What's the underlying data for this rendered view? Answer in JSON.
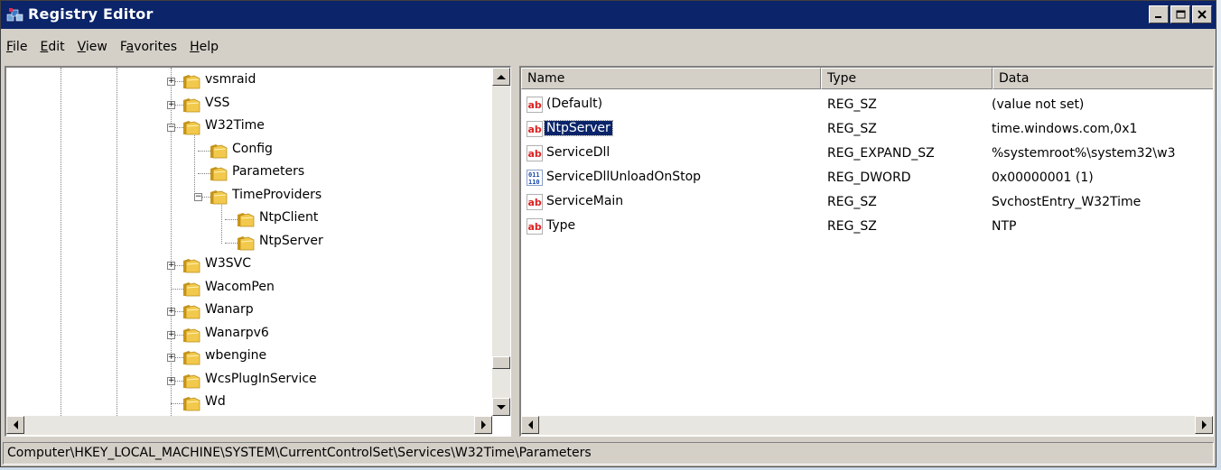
{
  "window": {
    "title": "Registry Editor"
  },
  "menu": [
    {
      "pre": "",
      "u": "F",
      "post": "ile"
    },
    {
      "pre": "",
      "u": "E",
      "post": "dit"
    },
    {
      "pre": "",
      "u": "V",
      "post": "iew"
    },
    {
      "pre": "F",
      "u": "a",
      "post": "vorites"
    },
    {
      "pre": "",
      "u": "H",
      "post": "elp"
    }
  ],
  "tree": {
    "nodes": [
      {
        "label": "vsmraid",
        "expander": "+"
      },
      {
        "label": "VSS",
        "expander": "+"
      },
      {
        "label": "W32Time",
        "expander": "-"
      },
      {
        "label": "Config",
        "expander": ""
      },
      {
        "label": "Parameters",
        "expander": ""
      },
      {
        "label": "TimeProviders",
        "expander": "-"
      },
      {
        "label": "NtpClient",
        "expander": ""
      },
      {
        "label": "NtpServer",
        "expander": ""
      },
      {
        "label": "W3SVC",
        "expander": "+"
      },
      {
        "label": "WacomPen",
        "expander": ""
      },
      {
        "label": "Wanarp",
        "expander": "+"
      },
      {
        "label": "Wanarpv6",
        "expander": "+"
      },
      {
        "label": "wbengine",
        "expander": "+"
      },
      {
        "label": "WcsPlugInService",
        "expander": "+"
      },
      {
        "label": "Wd",
        "expander": ""
      }
    ]
  },
  "list": {
    "columns": [
      "Name",
      "Type",
      "Data"
    ],
    "rows": [
      {
        "icon": "string-value-icon",
        "name": "(Default)",
        "type": "REG_SZ",
        "data": "(value not set)"
      },
      {
        "icon": "string-value-icon",
        "name": "NtpServer",
        "type": "REG_SZ",
        "data": "time.windows.com,0x1"
      },
      {
        "icon": "string-value-icon",
        "name": "ServiceDll",
        "type": "REG_EXPAND_SZ",
        "data": "%systemroot%\\system32\\w3"
      },
      {
        "icon": "binary-value-icon",
        "name": "ServiceDllUnloadOnStop",
        "type": "REG_DWORD",
        "data": "0x00000001 (1)"
      },
      {
        "icon": "string-value-icon",
        "name": "ServiceMain",
        "type": "REG_SZ",
        "data": "SvchostEntry_W32Time"
      },
      {
        "icon": "string-value-icon",
        "name": "Type",
        "type": "REG_SZ",
        "data": "NTP"
      }
    ],
    "selected_name": "NtpServer"
  },
  "status": {
    "path": "Computer\\HKEY_LOCAL_MACHINE\\SYSTEM\\CurrentControlSet\\Services\\W32Time\\Parameters"
  },
  "colors": {
    "titlebar": "#0b246a",
    "selection": "#0a246a",
    "chrome": "#d4d0c8",
    "folder": "#f2c94c"
  }
}
